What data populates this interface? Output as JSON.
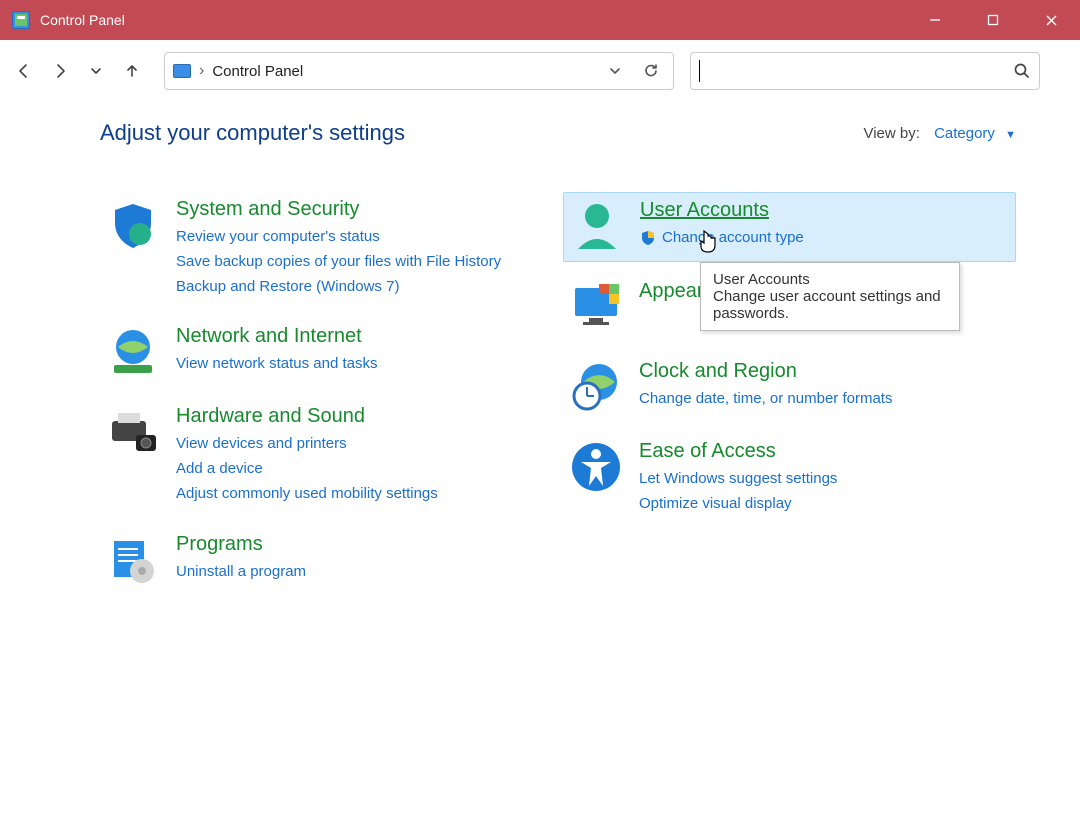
{
  "window": {
    "title": "Control Panel"
  },
  "toolbar": {
    "breadcrumb_sep": "›",
    "breadcrumb": "Control Panel"
  },
  "header": {
    "title": "Adjust your computer's settings",
    "viewby_label": "View by:",
    "viewby_value": "Category"
  },
  "categories": {
    "system_security": {
      "title": "System and Security",
      "links": [
        "Review your computer's status",
        "Save backup copies of your files with File History",
        "Backup and Restore (Windows 7)"
      ]
    },
    "network": {
      "title": "Network and Internet",
      "links": [
        "View network status and tasks"
      ]
    },
    "hardware": {
      "title": "Hardware and Sound",
      "links": [
        "View devices and printers",
        "Add a device",
        "Adjust commonly used mobility settings"
      ]
    },
    "programs": {
      "title": "Programs",
      "links": [
        "Uninstall a program"
      ]
    },
    "user_accounts": {
      "title": "User Accounts",
      "links": [
        "Change account type"
      ]
    },
    "appearance": {
      "title": "Appearance and Personalization",
      "links": []
    },
    "clock": {
      "title": "Clock and Region",
      "links": [
        "Change date, time, or number formats"
      ]
    },
    "ease": {
      "title": "Ease of Access",
      "links": [
        "Let Windows suggest settings",
        "Optimize visual display"
      ]
    }
  },
  "tooltip": {
    "title": "User Accounts",
    "body": "Change user account settings and passwords."
  }
}
